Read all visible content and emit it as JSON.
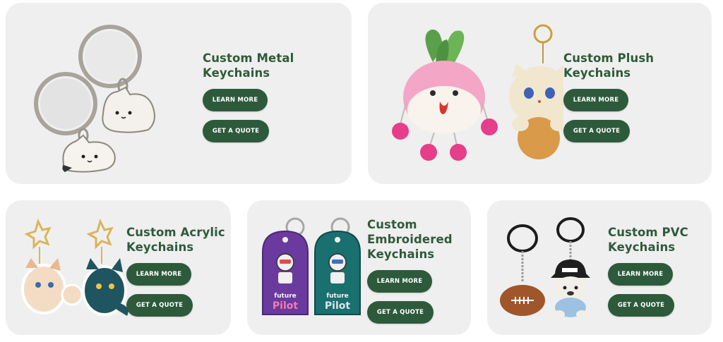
{
  "cards": [
    {
      "id": "metal",
      "title_line1": "Custom Metal",
      "title_line2": "Keychains",
      "learn_label": "LEARN MORE",
      "quote_label": "GET A QUOTE"
    },
    {
      "id": "plush",
      "title_line1": "Custom Plush",
      "title_line2": "Keychains",
      "learn_label": "LEARN MORE",
      "quote_label": "GET A QUOTE"
    },
    {
      "id": "acrylic",
      "title_line1": "Custom Acrylic",
      "title_line2": "Keychains",
      "learn_label": "LEARN MORE",
      "quote_label": "GET A QUOTE"
    },
    {
      "id": "embroidered",
      "title_line1": "Custom",
      "title_line2": "Embroidered",
      "title_line3": "Keychains",
      "learn_label": "LEARN MORE",
      "quote_label": "GET A QUOTE"
    },
    {
      "id": "pvc",
      "title_line1": "Custom PVC",
      "title_line2": "Keychains",
      "learn_label": "LEARN MORE",
      "quote_label": "GET A QUOTE"
    }
  ],
  "product_art_text": {
    "embroidered_tag_word1": "future",
    "embroidered_tag_word2": "Pilot"
  },
  "colors": {
    "card_background": "#efefef",
    "button_green": "#2d5a3b",
    "title_green": "#2f5b3a"
  }
}
